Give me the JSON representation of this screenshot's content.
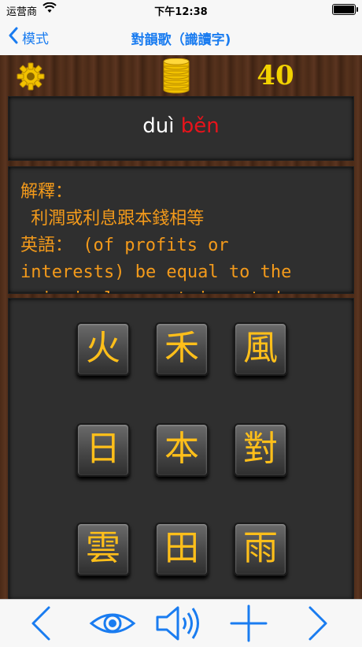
{
  "status": {
    "carrier": "运营商",
    "time": "下午12:38"
  },
  "nav": {
    "back_label": "模式",
    "title": "對韻歌（識讀字)"
  },
  "game": {
    "score": "40",
    "pinyin_1": "duì",
    "pinyin_2": "běn"
  },
  "explanation": {
    "text": "解釋：\n 利潤或利息跟本錢相等\n英語： (of profits or\ninterests) be equal to the\nprincipal amount invested"
  },
  "tiles": [
    "火",
    "禾",
    "風",
    "日",
    "本",
    "對",
    "雲",
    "田",
    "雨"
  ],
  "colors": {
    "accent": "#1a7cf0",
    "tile_text": "#ffbf1a",
    "pinyin_highlight": "#e8131b",
    "explanation_text": "#f39a1b",
    "score": "#f2d200"
  },
  "toolbar": {
    "icons": [
      "chevron-left-icon",
      "eye-icon",
      "speaker-icon",
      "plus-icon",
      "chevron-right-icon"
    ]
  }
}
